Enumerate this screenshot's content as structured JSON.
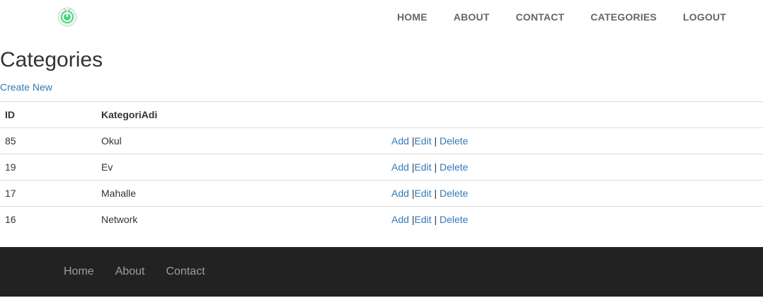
{
  "header": {
    "logo_icon": "power-icon",
    "nav": [
      "HOME",
      "ABOUT",
      "CONTACT",
      "CATEGORIES",
      "LOGOUT"
    ]
  },
  "main": {
    "title": "Categories",
    "create_link": "Create New",
    "table": {
      "columns": [
        "ID",
        "KategoriAdi"
      ],
      "rows": [
        {
          "id": "85",
          "name": "Okul"
        },
        {
          "id": "19",
          "name": "Ev"
        },
        {
          "id": "17",
          "name": "Mahalle"
        },
        {
          "id": "16",
          "name": "Network"
        }
      ],
      "actions": {
        "add": "Add",
        "edit": "Edit",
        "delete": "Delete",
        "sep1": "|",
        "sep2": "|"
      }
    }
  },
  "footer": {
    "nav": [
      "Home",
      "About",
      "Contact"
    ]
  },
  "colors": {
    "link": "#337ab7",
    "footer_bg": "#222222",
    "nav_text": "#666666",
    "logo_green": "#4cd47a"
  }
}
